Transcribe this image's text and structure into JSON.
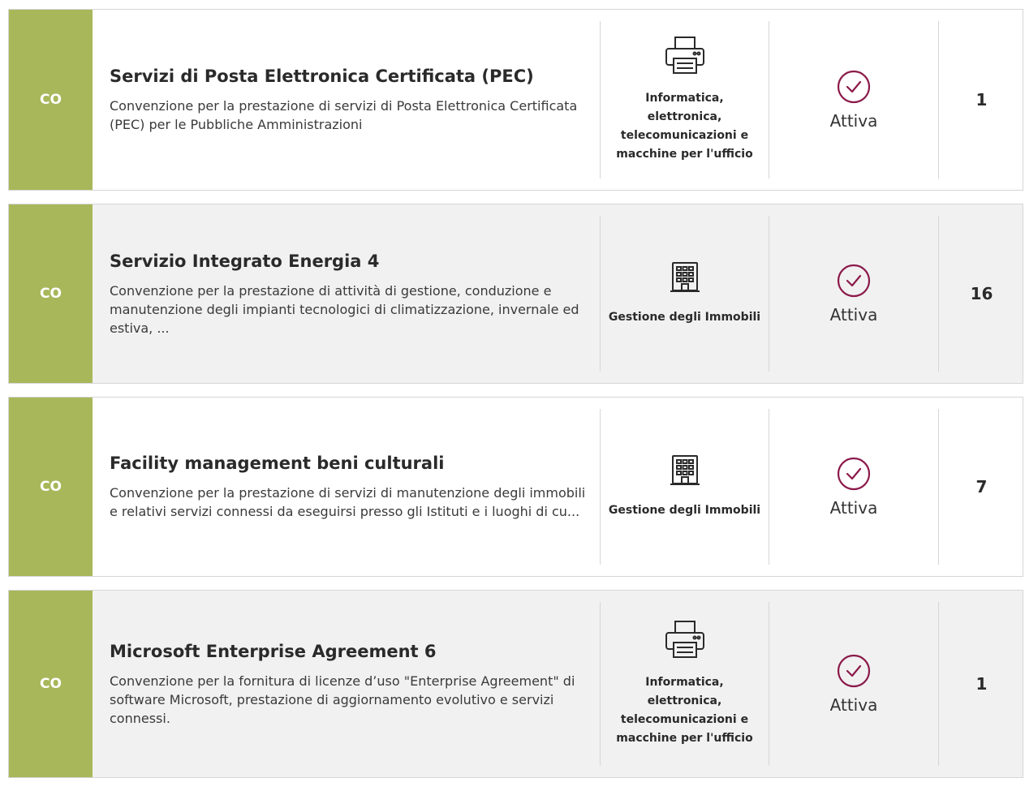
{
  "colors": {
    "code_badge": "#a8b75a",
    "status_icon": "#8b1a4a",
    "row_alt_bg": "#f1f1f1"
  },
  "rows": [
    {
      "code": "CO",
      "title": "Servizi di Posta Elettronica Certificata (PEC)",
      "description": "Convenzione per la prestazione di servizi di Posta Elettronica Certificata (PEC) per le Pubbliche Amministrazioni",
      "category_icon": "printer-icon",
      "category": "Informatica, elettronica, telecomunicazioni e macchine per l'ufficio",
      "status_icon": "check-circle-icon",
      "status": "Attiva",
      "count": "1"
    },
    {
      "code": "CO",
      "title": "Servizio Integrato Energia 4",
      "description": "Convenzione per la prestazione di attività di gestione, conduzione e manutenzione degli impianti tecnologici di climatizzazione, invernale ed estiva, ...",
      "category_icon": "building-icon",
      "category": "Gestione degli Immobili",
      "status_icon": "check-circle-icon",
      "status": "Attiva",
      "count": "16"
    },
    {
      "code": "CO",
      "title": "Facility management beni culturali",
      "description": "Convenzione per la prestazione di servizi di manutenzione degli immobili e relativi servizi connessi da eseguirsi presso gli Istituti e i luoghi di cu...",
      "category_icon": "building-icon",
      "category": "Gestione degli Immobili",
      "status_icon": "check-circle-icon",
      "status": "Attiva",
      "count": "7"
    },
    {
      "code": "CO",
      "title": "Microsoft Enterprise Agreement 6",
      "description": "Convenzione per la fornitura di licenze d’uso \"Enterprise Agreement\" di software Microsoft, prestazione di aggiornamento evolutivo e servizi connessi.",
      "category_icon": "printer-icon",
      "category": "Informatica, elettronica, telecomunicazioni e macchine per l'ufficio",
      "status_icon": "check-circle-icon",
      "status": "Attiva",
      "count": "1"
    }
  ]
}
